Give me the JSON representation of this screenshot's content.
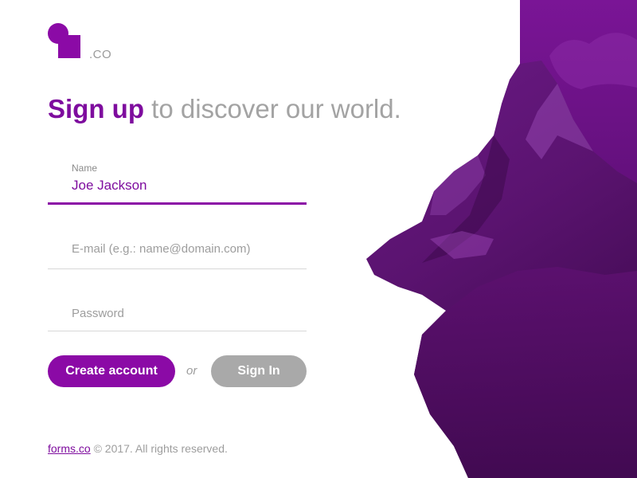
{
  "brand": {
    "suffix": ".CO",
    "color": "#8b0aa6"
  },
  "headline": {
    "accent": "Sign up",
    "rest": " to discover our world."
  },
  "form": {
    "name": {
      "label": "Name",
      "value": "Joe Jackson"
    },
    "email": {
      "placeholder": "E-mail (e.g.: name@domain.com)"
    },
    "password": {
      "placeholder": "Password"
    }
  },
  "actions": {
    "create": "Create account",
    "or": "or",
    "signin": "Sign In"
  },
  "footer": {
    "link": "forms.co",
    "text": " © 2017. All rights reserved."
  },
  "colors": {
    "accent": "#8b0aa6",
    "muted": "#a3a3a3",
    "secondary_button": "#a9a9a9"
  }
}
